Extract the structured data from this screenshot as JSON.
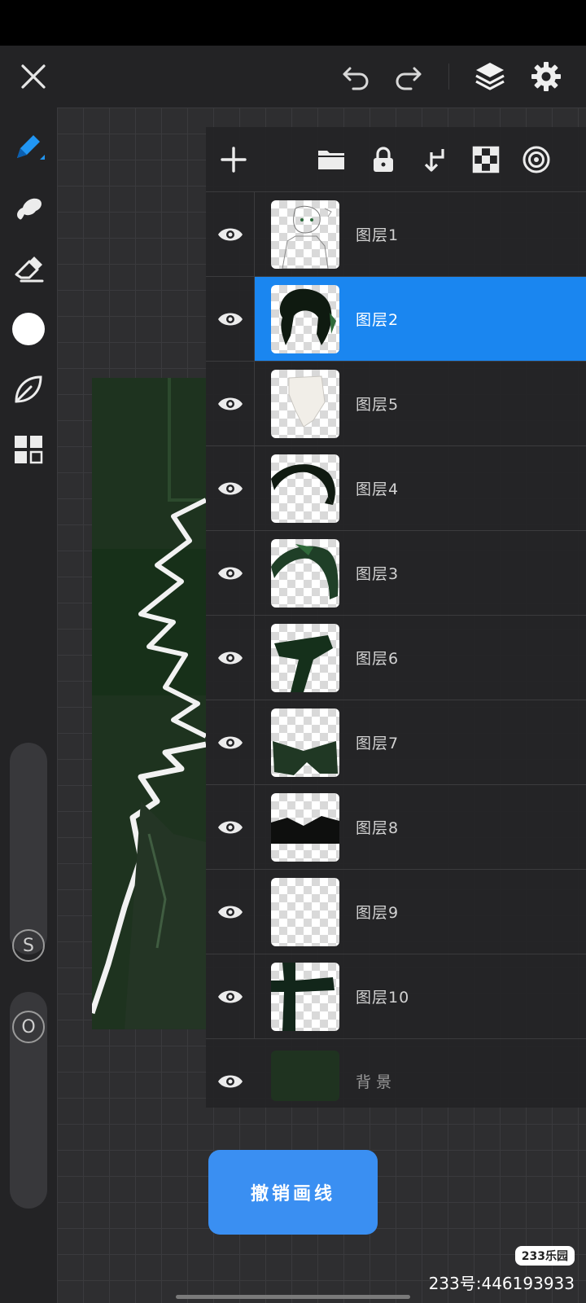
{
  "toolbar": {
    "close_icon": "close-icon",
    "undo_icon": "undo-icon",
    "redo_icon": "redo-icon",
    "layers_icon": "layers-icon",
    "settings_icon": "gear-icon"
  },
  "tools": [
    {
      "name": "brush",
      "icon": "pen-icon",
      "active": true
    },
    {
      "name": "smudge",
      "icon": "smudge-icon"
    },
    {
      "name": "eraser",
      "icon": "eraser-icon"
    },
    {
      "name": "color",
      "icon": "color-swatch",
      "color": "#ffffff"
    },
    {
      "name": "adjust",
      "icon": "leaf-icon"
    },
    {
      "name": "gallery",
      "icon": "grid-icon"
    }
  ],
  "sliders": {
    "size_label": "S",
    "opacity_label": "O"
  },
  "layers_panel": {
    "toolbar_icons": [
      "add-icon",
      "folder-icon",
      "lock-icon",
      "merge-down-icon",
      "checker-icon",
      "target-icon"
    ],
    "layers": [
      {
        "name": "图层1",
        "selected": false
      },
      {
        "name": "图层2",
        "selected": true
      },
      {
        "name": "图层5",
        "selected": false
      },
      {
        "name": "图层4",
        "selected": false
      },
      {
        "name": "图层3",
        "selected": false
      },
      {
        "name": "图层6",
        "selected": false
      },
      {
        "name": "图层7",
        "selected": false
      },
      {
        "name": "图层8",
        "selected": false
      },
      {
        "name": "图层9",
        "selected": false
      },
      {
        "name": "图层10",
        "selected": false
      },
      {
        "name": "背景",
        "selected": false,
        "background": true
      }
    ]
  },
  "undo_stroke_label": "撤销画线",
  "watermark": {
    "logo": "233乐园",
    "id": "233号:446193933"
  },
  "colors": {
    "accent": "#1a86f0",
    "panel": "#242426",
    "background_layer": "#1f3320"
  }
}
